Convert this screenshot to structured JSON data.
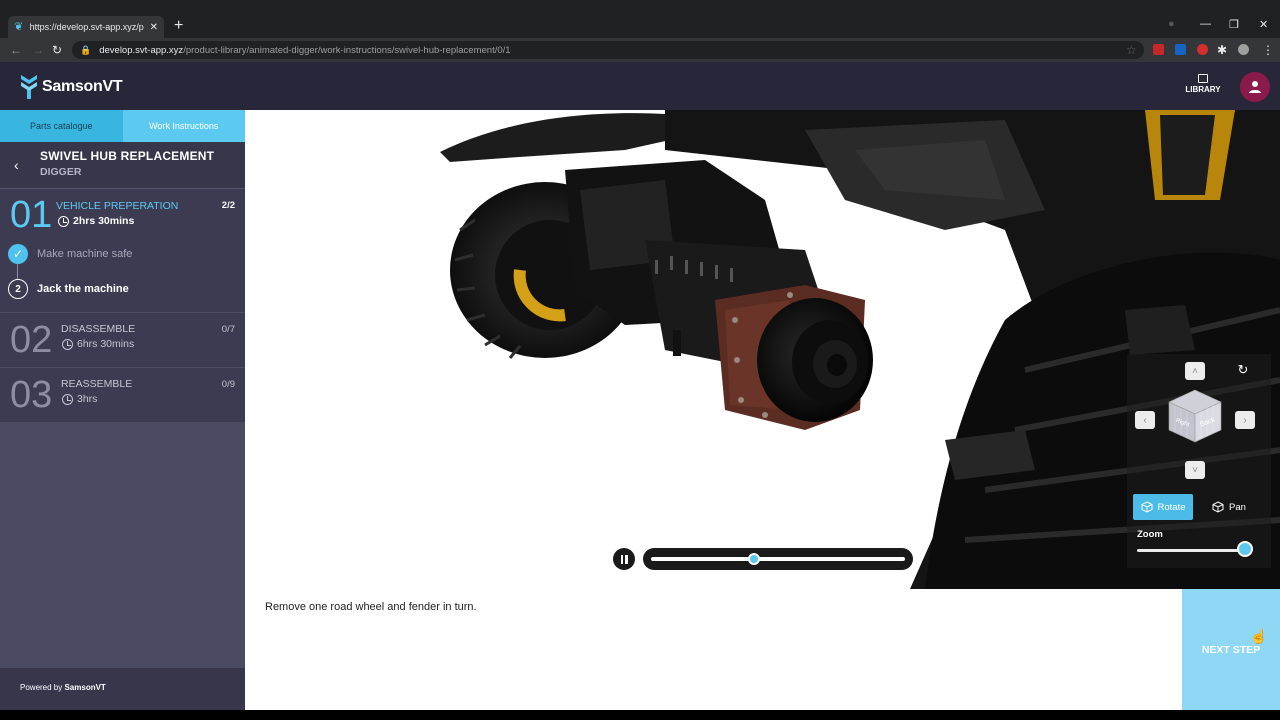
{
  "browser": {
    "tab_title": "https://develop.svt-app.xyz/product",
    "new_tab": "+",
    "url_host": "develop.svt-app.xyz",
    "url_path": "/product-library/animated-digger/work-instructions/swivel-hub-replacement/0/1"
  },
  "header": {
    "logo_text": "SamsonVT",
    "library_label": "LIBRARY"
  },
  "sidebar": {
    "tabs": [
      {
        "label": "Parts catalogue"
      },
      {
        "label": "Work Instructions"
      }
    ],
    "procedure": {
      "title": "SWIVEL HUB REPLACEMENT",
      "subtitle": "DIGGER"
    },
    "sections": [
      {
        "number": "01",
        "name": "VEHICLE PREPERATION",
        "time": "2hrs 30mins",
        "count": "2/2",
        "steps": [
          {
            "marker": "✓",
            "label": "Make machine safe",
            "status": "done"
          },
          {
            "marker": "2",
            "label": "Jack the machine",
            "status": "current"
          }
        ]
      },
      {
        "number": "02",
        "name": "DISASSEMBLE",
        "time": "6hrs 30mins",
        "count": "0/7"
      },
      {
        "number": "03",
        "name": "REASSEMBLE",
        "time": "3hrs",
        "count": "0/9"
      }
    ],
    "powered_prefix": "Powered by ",
    "powered_brand": "SamsonVT"
  },
  "viewer": {
    "playback_progress": 0.4,
    "view_cube": {
      "face_back": "Back",
      "face_right": "Right"
    },
    "modes": [
      {
        "label": "Rotate",
        "active": true
      },
      {
        "label": "Pan",
        "active": false
      }
    ],
    "zoom_label": "Zoom",
    "zoom_level": 1.0
  },
  "instruction": {
    "text": "Remove one road wheel and fender in turn."
  },
  "next_step_label": "NEXT STEP",
  "colors": {
    "accent": "#4fc3f0",
    "header_bg": "#28273a",
    "sidebar_bg": "#4a4a62",
    "next_step_bg": "#8ed8f5"
  }
}
